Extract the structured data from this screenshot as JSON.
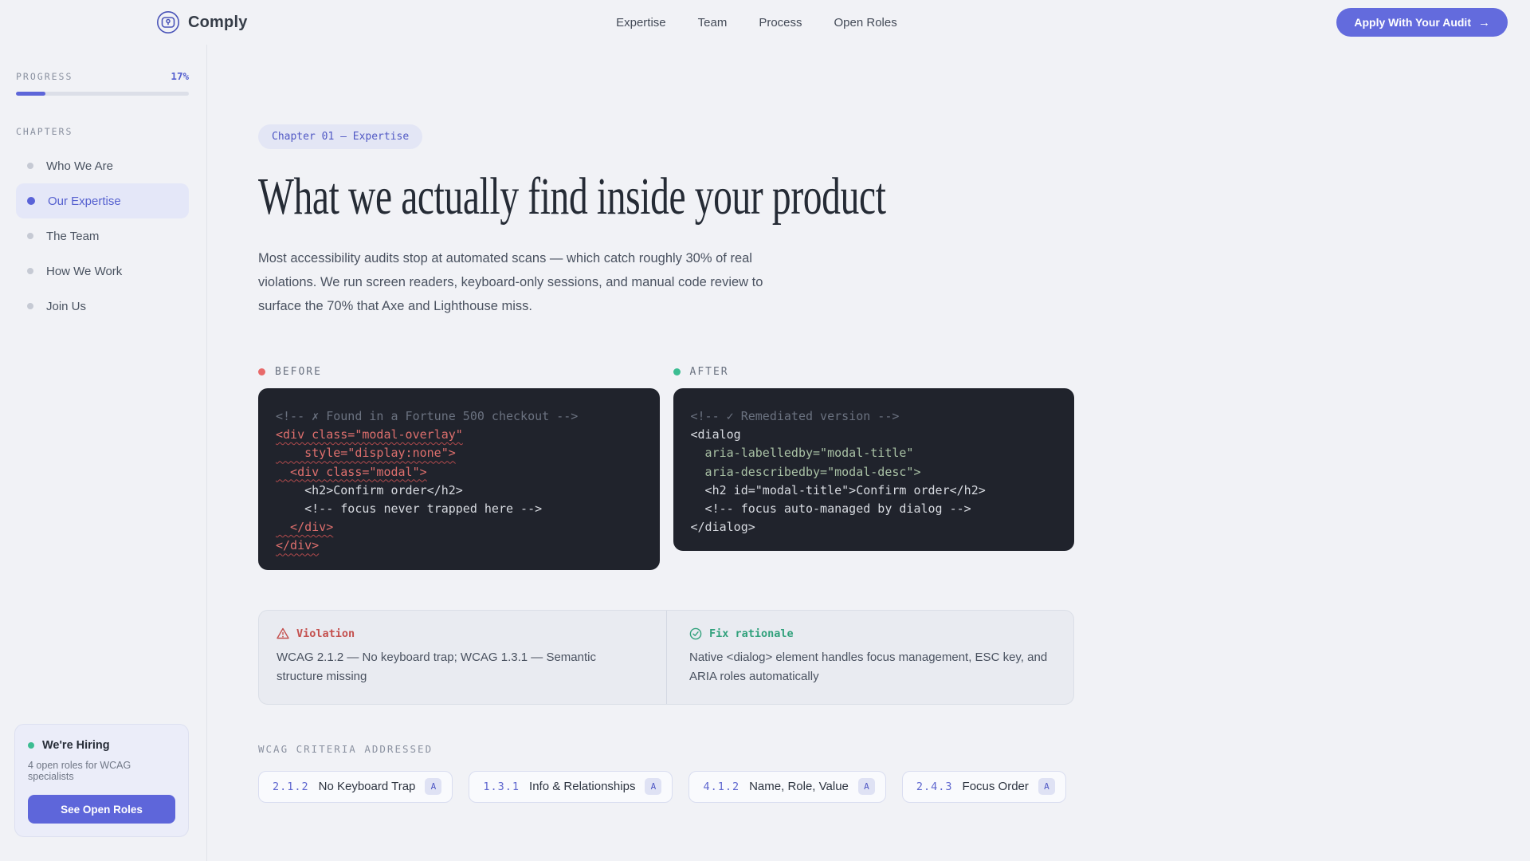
{
  "header": {
    "brand": "Comply",
    "nav": [
      {
        "label": "Expertise"
      },
      {
        "label": "Team"
      },
      {
        "label": "Process"
      },
      {
        "label": "Open Roles"
      }
    ],
    "cta_label": "Apply With Your Audit",
    "cta_arrow": "→"
  },
  "sidebar": {
    "progress_label": "PROGRESS",
    "progress_value": "17%",
    "progress_percent": 17,
    "chapters_label": "CHAPTERS",
    "chapters": [
      {
        "label": "Who We Are",
        "active": false
      },
      {
        "label": "Our Expertise",
        "active": true
      },
      {
        "label": "The Team",
        "active": false
      },
      {
        "label": "How We Work",
        "active": false
      },
      {
        "label": "Join Us",
        "active": false
      }
    ],
    "hiring": {
      "title": "We're Hiring",
      "subtitle": "4 open roles for WCAG specialists",
      "button": "See Open Roles"
    }
  },
  "main": {
    "chapter_badge": "Chapter 01 — Expertise",
    "title": "What we actually find inside your product",
    "intro": "Most accessibility audits stop at automated scans — which catch roughly 30% of real violations. We run screen readers, keyboard-only sessions, and manual code review to surface the 70% that Axe and Lighthouse miss.",
    "before": {
      "label": "BEFORE",
      "lines": [
        {
          "style": "comment",
          "text": "<!-- ✗ Found in a Fortune 500 checkout -->"
        },
        {
          "style": "err",
          "text": "<div class=\"modal-overlay\""
        },
        {
          "style": "err",
          "text": "    style=\"display:none\">"
        },
        {
          "style": "err",
          "text": "  <div class=\"modal\">"
        },
        {
          "style": "plain",
          "text": "    <h2>Confirm order</h2>"
        },
        {
          "style": "plain",
          "text": "    <!-- focus never trapped here -->"
        },
        {
          "style": "err",
          "text": "  </div>"
        },
        {
          "style": "err",
          "text": "</div>"
        }
      ]
    },
    "after": {
      "label": "AFTER",
      "lines": [
        {
          "style": "comment",
          "text": "<!-- ✓ Remediated version -->"
        },
        {
          "style": "plain",
          "text": "<dialog"
        },
        {
          "style": "green",
          "text": "  aria-labelledby=\"modal-title\""
        },
        {
          "style": "green",
          "text": "  aria-describedby=\"modal-desc\">"
        },
        {
          "style": "plain",
          "text": "  <h2 id=\"modal-title\">Confirm order</h2>"
        },
        {
          "style": "plain",
          "text": "  <!-- focus auto-managed by dialog -->"
        },
        {
          "style": "plain",
          "text": "</dialog>"
        }
      ]
    },
    "violation": {
      "title": "Violation",
      "body": "WCAG 2.1.2 — No keyboard trap; WCAG 1.3.1 — Semantic structure missing"
    },
    "fix": {
      "title": "Fix rationale",
      "body": "Native <dialog> element handles focus management, ESC key, and ARIA roles automatically"
    },
    "criteria_label": "WCAG CRITERIA ADDRESSED",
    "criteria": [
      {
        "code": "2.1.2",
        "name": "No Keyboard Trap",
        "level": "A"
      },
      {
        "code": "1.3.1",
        "name": "Info & Relationships",
        "level": "A"
      },
      {
        "code": "4.1.2",
        "name": "Name, Role, Value",
        "level": "A"
      },
      {
        "code": "2.4.3",
        "name": "Focus Order",
        "level": "A"
      }
    ]
  },
  "colors": {
    "accent": "#636bdd",
    "accent_text": "#5560cf",
    "page_bg": "#f1f2f6",
    "code_bg": "#20232c",
    "error_red": "#de6f6d",
    "success_green": "#3cbd92",
    "violation_red": "#c4504e",
    "fix_green": "#31a17c"
  }
}
